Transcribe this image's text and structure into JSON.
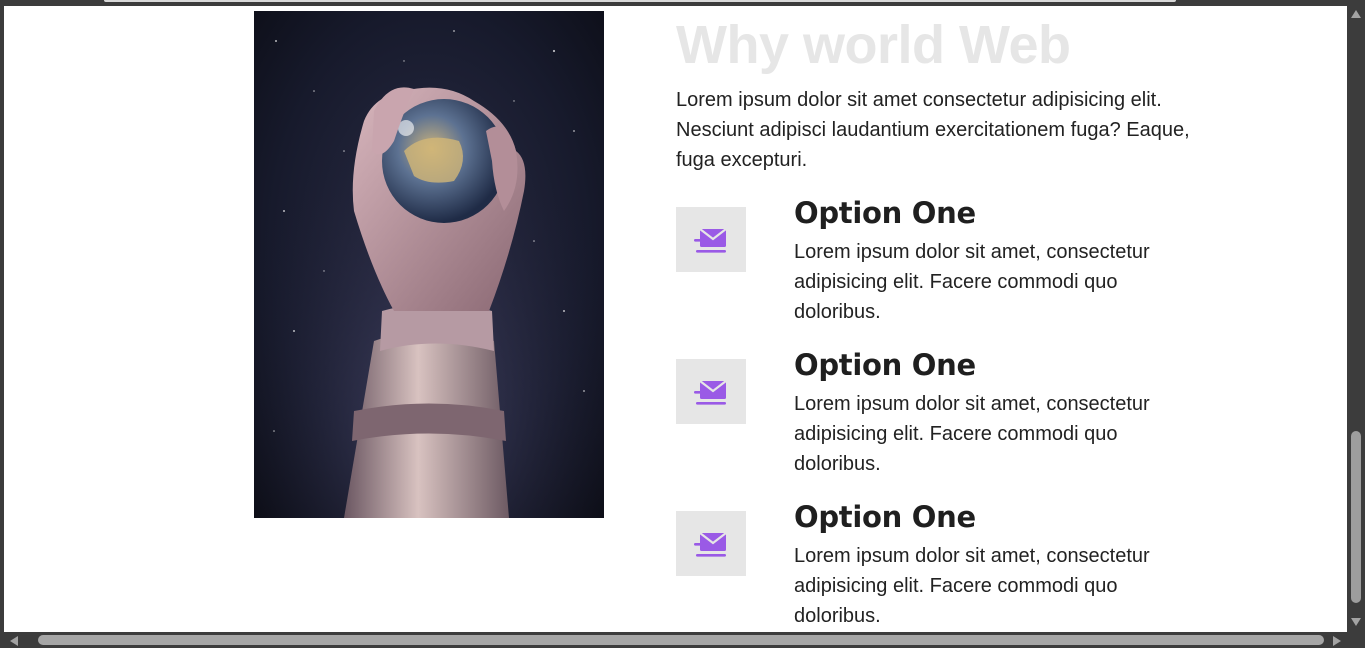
{
  "section": {
    "title": "Why world Web",
    "intro": "Lorem ipsum dolor sit amet consectetur adipisicing elit. Nesciunt adipisci laudantium exercitationem fuga? Eaque, fuga excepturi.",
    "hero_image": "astronaut-hand-holding-earth-image"
  },
  "features": [
    {
      "icon": "fast-mail-icon",
      "title": "Option One",
      "text": "Lorem ipsum dolor sit amet, consectetur adipisicing elit. Facere commodi quo doloribus."
    },
    {
      "icon": "fast-mail-icon",
      "title": "Option One",
      "text": "Lorem ipsum dolor sit amet, consectetur adipisicing elit. Facere commodi quo doloribus."
    },
    {
      "icon": "fast-mail-icon",
      "title": "Option One",
      "text": "Lorem ipsum dolor sit amet, consectetur adipisicing elit. Facere commodi quo doloribus."
    }
  ],
  "colors": {
    "accent": "#9a5ae6",
    "title_faded": "#e6e6e6",
    "icon_box": "#e6e6e6",
    "text": "#222222"
  }
}
